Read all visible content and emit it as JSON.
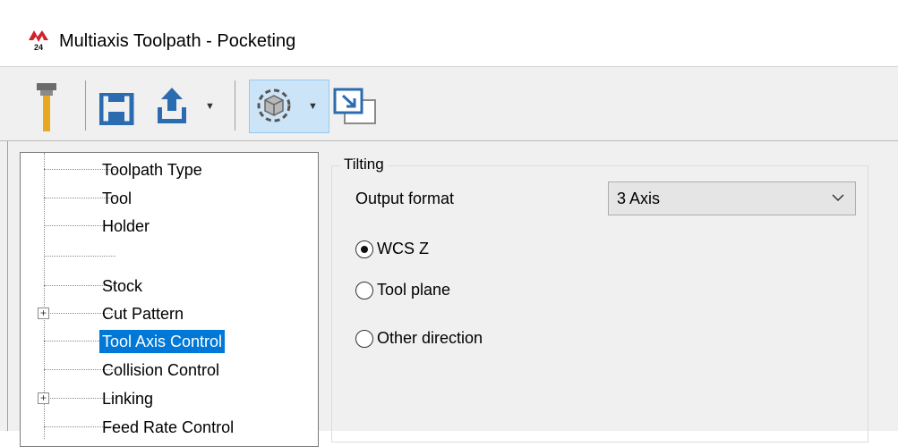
{
  "window": {
    "title": "Multiaxis Toolpath - Pocketing",
    "logo_text": "24"
  },
  "toolbar": {
    "icons": [
      "tool-icon",
      "save-icon",
      "export-icon",
      "view-icon",
      "preview-icon"
    ],
    "accent_blue": "#2b6cb0",
    "tool_color": "#e8a822"
  },
  "tree": {
    "items": [
      {
        "label": "Toolpath Type",
        "expandable": false
      },
      {
        "label": "Tool",
        "expandable": false
      },
      {
        "label": "Holder",
        "expandable": false
      },
      {
        "label": "",
        "expandable": false
      },
      {
        "label": "Stock",
        "expandable": false
      },
      {
        "label": "Cut Pattern",
        "expandable": true
      },
      {
        "label": "Tool Axis Control",
        "expandable": false,
        "selected": true
      },
      {
        "label": "Collision Control",
        "expandable": false
      },
      {
        "label": "Linking",
        "expandable": true
      },
      {
        "label": "Feed Rate Control",
        "expandable": false
      }
    ]
  },
  "tilting": {
    "group_title": "Tilting",
    "output_format_label": "Output format",
    "output_format_value": "3 Axis",
    "radios": [
      {
        "label": "WCS Z",
        "checked": true
      },
      {
        "label": "Tool plane",
        "checked": false
      },
      {
        "label": "Other direction",
        "checked": false
      }
    ]
  }
}
